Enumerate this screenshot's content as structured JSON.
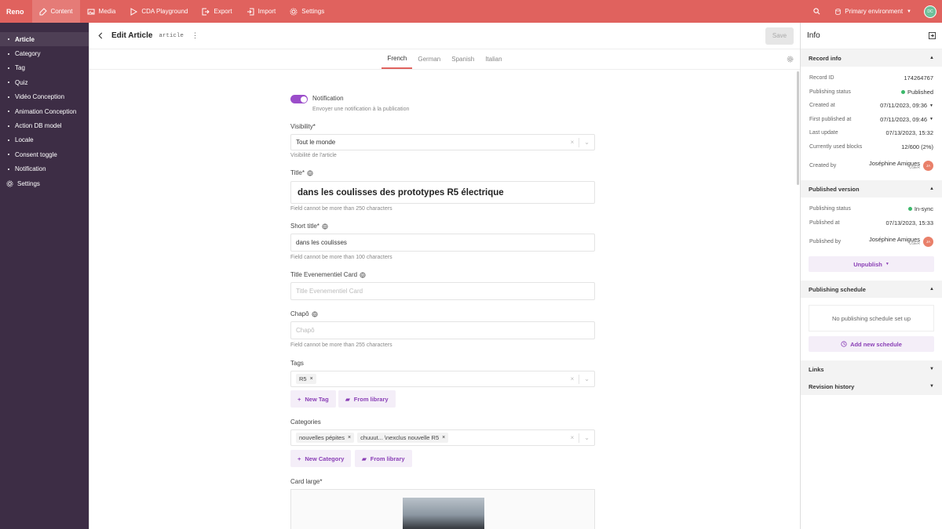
{
  "topbar": {
    "brand": "Reno",
    "nav": [
      {
        "label": "Content",
        "icon": "edit-icon",
        "active": true
      },
      {
        "label": "Media",
        "icon": "image-icon"
      },
      {
        "label": "CDA Playground",
        "icon": "play-icon"
      },
      {
        "label": "Export",
        "icon": "export-icon"
      },
      {
        "label": "Import",
        "icon": "import-icon"
      },
      {
        "label": "Settings",
        "icon": "gear-icon"
      }
    ],
    "environment": "Primary environment",
    "user_initials": "DC"
  },
  "sidebar": {
    "items": [
      "Article",
      "Category",
      "Tag",
      "Quiz",
      "Vidéo Conception",
      "Animation Conception",
      "Action DB model",
      "Locale",
      "Consent toggle",
      "Notification"
    ],
    "settings": "Settings"
  },
  "editor": {
    "title": "Edit Article",
    "model_key": "article",
    "save": "Save",
    "languages": [
      "French",
      "German",
      "Spanish",
      "Italian"
    ],
    "active_language": "French"
  },
  "form": {
    "notification": {
      "label": "Notification",
      "hint": "Envoyer une notification à la publication",
      "enabled": true
    },
    "visibility": {
      "label": "Visibility*",
      "value": "Tout le monde",
      "hint": "Visibilité de l'article"
    },
    "title": {
      "label": "Title*",
      "value": "dans les coulisses des prototypes R5 électrique",
      "hint": "Field cannot be more than 250 characters"
    },
    "short_title": {
      "label": "Short title*",
      "value": "dans les coulisses",
      "hint": "Field cannot be more than 100 characters"
    },
    "title_event": {
      "label": "Title Evenementiel Card",
      "placeholder": "Title Evenementiel Card"
    },
    "chapo": {
      "label": "Chapô",
      "placeholder": "Chapô",
      "hint": "Field cannot be more than 255 characters"
    },
    "tags": {
      "label": "Tags",
      "chips": [
        "R5"
      ],
      "new_label": "New Tag",
      "library_label": "From library"
    },
    "categories": {
      "label": "Categories",
      "chips": [
        "nouvelles pépites",
        "chuuut... \\nexclus nouvelle R5"
      ],
      "new_label": "New Category",
      "library_label": "From library"
    },
    "card_large": {
      "label": "Card large*"
    }
  },
  "panel": {
    "title": "Info",
    "record_info": {
      "heading": "Record info",
      "record_id_label": "Record ID",
      "record_id": "174264767",
      "status_label": "Publishing status",
      "status": "Published",
      "created_label": "Created at",
      "created": "07/11/2023, 09:36",
      "first_pub_label": "First published at",
      "first_pub": "07/11/2023, 09:46",
      "last_update_label": "Last update",
      "last_update": "07/13/2023, 15:32",
      "blocks_label": "Currently used blocks",
      "blocks": "12/600 (2%)",
      "created_by_label": "Created by",
      "created_by": "Joséphine Amigues",
      "created_by_role": "USER",
      "created_by_initials": "JA"
    },
    "published_version": {
      "heading": "Published version",
      "status_label": "Publishing status",
      "status": "In-sync",
      "published_at_label": "Published at",
      "published_at": "07/13/2023, 15:33",
      "published_by_label": "Published by",
      "published_by": "Joséphine Amigues",
      "published_by_role": "USER",
      "published_by_initials": "JA",
      "unpublish": "Unpublish"
    },
    "schedule": {
      "heading": "Publishing schedule",
      "empty": "No publishing schedule set up",
      "add": "Add new schedule"
    },
    "links": "Links",
    "revision_history": "Revision history"
  },
  "colors": {
    "topbar": "#e0625e",
    "sidebar": "#3d2d45",
    "accent": "#9b4dca",
    "published": "#3bb86a"
  }
}
